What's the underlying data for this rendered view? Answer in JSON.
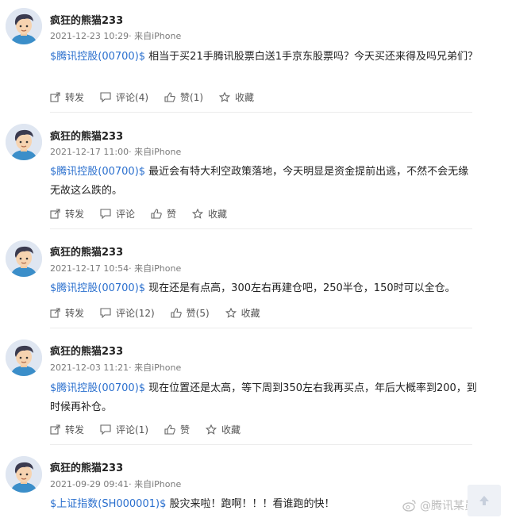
{
  "posts": [
    {
      "username": "疯狂的熊猫233",
      "meta": "2021-12-23 10:29· 来自iPhone",
      "tag": "$腾讯控股(00700)$",
      "text": " 相当于买21手腾讯股票白送1手京东股票吗？今天买还来得及吗兄弟们？",
      "repost": "转发",
      "comment": "评论(4)",
      "like": "赞(1)",
      "collect": "收藏"
    },
    {
      "username": "疯狂的熊猫233",
      "meta": "2021-12-17 11:00· 来自iPhone",
      "tag": "$腾讯控股(00700)$",
      "text": " 最近会有特大利空政策落地，今天明显是资金提前出逃，不然不会无缘无故这么跌的。",
      "repost": "转发",
      "comment": "评论",
      "like": "赞",
      "collect": "收藏"
    },
    {
      "username": "疯狂的熊猫233",
      "meta": "2021-12-17 10:54· 来自iPhone",
      "tag": "$腾讯控股(00700)$",
      "text": " 现在还是有点高，300左右再建仓吧，250半仓，150时可以全仓。",
      "repost": "转发",
      "comment": "评论(12)",
      "like": "赞(5)",
      "collect": "收藏"
    },
    {
      "username": "疯狂的熊猫233",
      "meta": "2021-12-03 11:21· 来自iPhone",
      "tag": "$腾讯控股(00700)$",
      "text": " 现在位置还是太高，等下周到350左右我再买点，年后大概率到200，到时候再补仓。",
      "repost": "转发",
      "comment": "评论(1)",
      "like": "赞",
      "collect": "收藏"
    },
    {
      "username": "疯狂的熊猫233",
      "meta": "2021-09-29 09:41· 来自iPhone",
      "tag": "$上证指数(SH000001)$",
      "text": " 股灾来啦！跑啊！！！看谁跑的快！"
    }
  ],
  "watermark": "@腾讯某员工",
  "colors": {
    "link": "#2a6fce",
    "meta": "#7a7a7a",
    "text": "#222222"
  }
}
